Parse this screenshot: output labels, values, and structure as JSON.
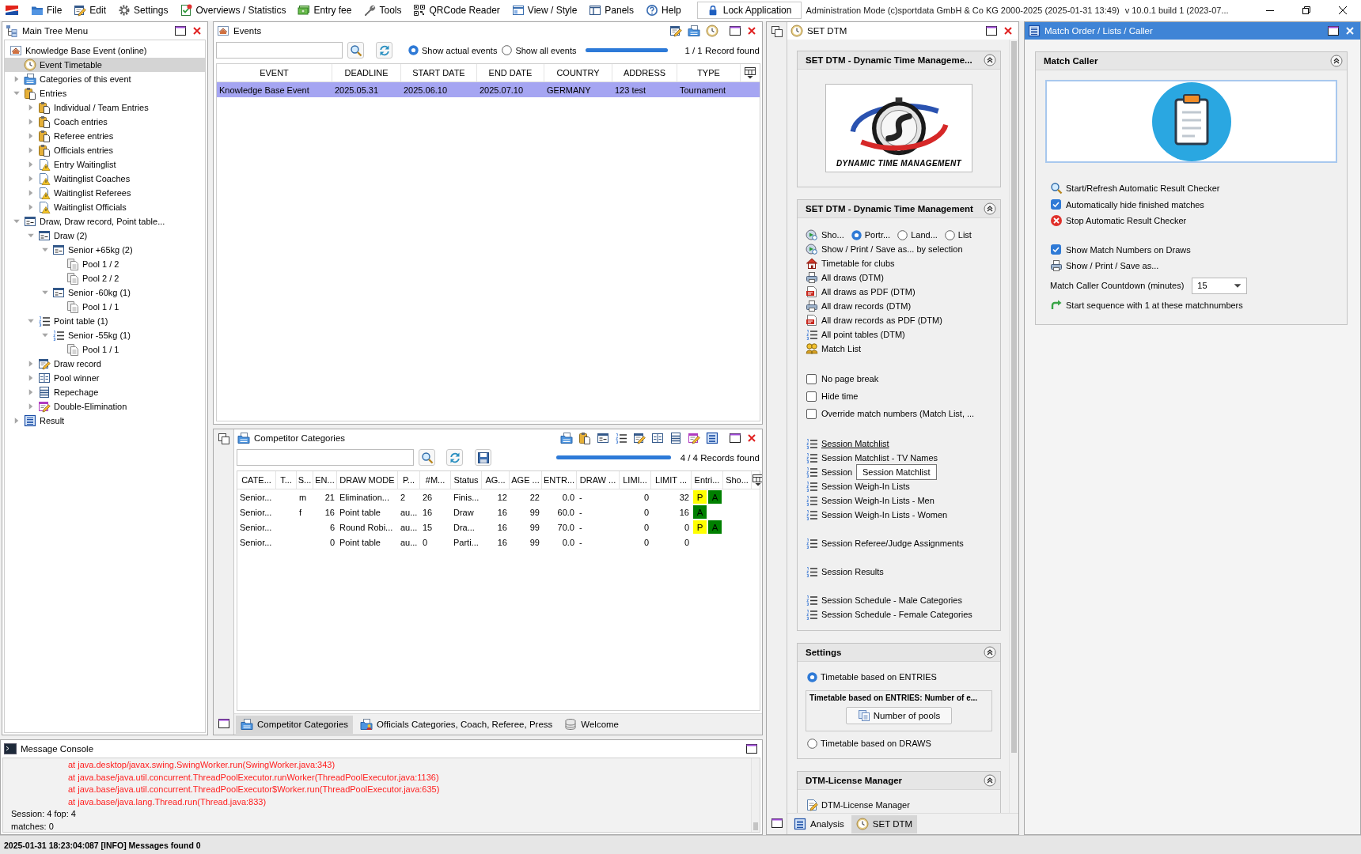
{
  "menubar": {
    "items": [
      {
        "label": "File",
        "kind": "file"
      },
      {
        "label": "Edit",
        "kind": "edit"
      },
      {
        "label": "Settings",
        "kind": "settings"
      },
      {
        "label": "Overviews / Statistics",
        "kind": "overview"
      },
      {
        "label": "Entry fee",
        "kind": "fee"
      },
      {
        "label": "Tools",
        "kind": "tools"
      },
      {
        "label": "QRCode Reader",
        "kind": "qr"
      },
      {
        "label": "View / Style",
        "kind": "view"
      },
      {
        "label": "Panels",
        "kind": "panels"
      },
      {
        "label": "Help",
        "kind": "help"
      }
    ],
    "lock_button": "Lock Application",
    "title": "Administration Mode (c)sportdata GmbH & Co KG 2000-2025 (2025-01-31 13:49)",
    "version": "v 10.0.1 build 1 (2023-07..."
  },
  "tree_panel": {
    "title": "Main Tree Menu",
    "active": false,
    "items": [
      {
        "label": "Knowledge Base Event (online)",
        "kind": "event",
        "selected": false,
        "children": [
          {
            "label": "Event Timetable",
            "kind": "timetable",
            "selected": true
          },
          {
            "label": "Categories of this event",
            "kind": "categories",
            "selected": false,
            "expanded": false
          },
          {
            "label": "Entries",
            "kind": "entries",
            "selected": false,
            "expanded": true,
            "children": [
              {
                "label": "Individual / Team Entries",
                "kind": "entries",
                "selected": false,
                "expanded": false
              },
              {
                "label": "Coach entries",
                "kind": "entries",
                "selected": false,
                "expanded": false
              },
              {
                "label": "Referee entries",
                "kind": "entries",
                "selected": false,
                "expanded": false
              },
              {
                "label": "Officials entries",
                "kind": "entries",
                "selected": false,
                "expanded": false
              },
              {
                "label": "Entry Waitinglist",
                "kind": "waitinglist",
                "selected": false,
                "expanded": false
              },
              {
                "label": "Waitinglist Coaches",
                "kind": "waitinglist",
                "selected": false,
                "expanded": false
              },
              {
                "label": "Waitinglist Referees",
                "kind": "waitinglist",
                "selected": false,
                "expanded": false
              },
              {
                "label": "Waitinglist Officials",
                "kind": "waitinglist",
                "selected": false,
                "expanded": false
              }
            ]
          },
          {
            "label": "Draw, Draw record, Point table...",
            "kind": "draw",
            "selected": false,
            "expanded": true,
            "children": [
              {
                "label": "Draw (2)",
                "kind": "draw",
                "selected": false,
                "expanded": true,
                "children": [
                  {
                    "label": "Senior +65kg (2)",
                    "kind": "draw",
                    "selected": false,
                    "expanded": true,
                    "children": [
                      {
                        "label": "Pool 1 / 2",
                        "kind": "pool",
                        "selected": false
                      },
                      {
                        "label": "Pool 2 / 2",
                        "kind": "pool",
                        "selected": false
                      }
                    ]
                  },
                  {
                    "label": "Senior -60kg (1)",
                    "kind": "draw",
                    "selected": false,
                    "expanded": true,
                    "children": [
                      {
                        "label": "Pool 1 / 1",
                        "kind": "pool",
                        "selected": false
                      }
                    ]
                  }
                ]
              },
              {
                "label": "Point table (1)",
                "kind": "pointtable",
                "selected": false,
                "expanded": true,
                "children": [
                  {
                    "label": "Senior -55kg (1)",
                    "kind": "pointtable",
                    "selected": false,
                    "expanded": true,
                    "children": [
                      {
                        "label": "Pool 1 / 1",
                        "kind": "pool",
                        "selected": false
                      }
                    ]
                  }
                ]
              },
              {
                "label": "Draw record",
                "kind": "record",
                "selected": false,
                "expanded": false
              },
              {
                "label": "Pool winner",
                "kind": "winner",
                "selected": false,
                "expanded": false
              },
              {
                "label": "Repechage",
                "kind": "repechage",
                "selected": false,
                "expanded": false
              },
              {
                "label": "Double-Elimination",
                "kind": "elimination",
                "selected": false,
                "expanded": false
              }
            ]
          },
          {
            "label": "Result",
            "kind": "result",
            "selected": false,
            "expanded": false
          }
        ]
      }
    ]
  },
  "events_panel": {
    "title": "Events",
    "active": false,
    "radios": [
      {
        "label": "Show actual events",
        "selected": true
      },
      {
        "label": "Show all events",
        "selected": false
      }
    ],
    "progress": {
      "level": 1
    },
    "record_count": "1 / 1 Record found",
    "table": {
      "columns": [
        "EVENT",
        "DEADLINE",
        "START DATE",
        "END DATE",
        "COUNTRY",
        "ADDRESS",
        "TYPE"
      ],
      "rows": [
        {
          "selected": true,
          "cells": [
            "Knowledge Base Event",
            "2025.05.31",
            "2025.06.10",
            "2025.07.10",
            "GERMANY",
            "123 test",
            "Tournament"
          ]
        }
      ]
    }
  },
  "categories_panel": {
    "title": "Competitor Categories",
    "active": false,
    "progress": {
      "level": 1
    },
    "record_count": "4 / 4 Records found",
    "table": {
      "columns": [
        "CATE...",
        "T...",
        "S...",
        "EN...",
        "DRAW MODE",
        "P...",
        "#M...",
        "Status",
        "AG...",
        "AGE ...",
        "ENTR...",
        "DRAW ...",
        "LIMI...",
        "LIMIT ...",
        "Entri...",
        "Sho..."
      ],
      "rows": [
        {
          "cells": [
            "Senior...",
            null,
            "m",
            "21",
            "Elimination...",
            "2",
            "26",
            "Finis...",
            "12",
            "22",
            "0.0",
            "-",
            "0",
            "32"
          ],
          "entries": [
            {
              "label": "P",
              "color": "#ffff00"
            },
            {
              "label": "A",
              "color": "#008000"
            }
          ]
        },
        {
          "cells": [
            "Senior...",
            null,
            "f",
            "16",
            "Point table",
            "au...",
            "16",
            "Draw",
            "16",
            "99",
            "60.0",
            "-",
            "0",
            "16"
          ],
          "entries": [
            {
              "label": "A",
              "color": "#008000"
            }
          ]
        },
        {
          "cells": [
            "Senior...",
            null,
            null,
            "6",
            "Round Robi...",
            "au...",
            "15",
            "Dra...",
            "16",
            "99",
            "70.0",
            "-",
            "0",
            "0"
          ],
          "entries": [
            {
              "label": "P",
              "color": "#ffff00"
            },
            {
              "label": "A",
              "color": "#008000"
            }
          ]
        },
        {
          "cells": [
            "Senior...",
            null,
            null,
            "0",
            "Point table",
            "au...",
            "0",
            "Parti...",
            "16",
            "99",
            "0.0",
            "-",
            "0",
            "0"
          ]
        }
      ]
    },
    "tabs": [
      {
        "label": "Competitor Categories",
        "kind": "categories",
        "selected": true
      },
      {
        "label": "Officials Categories, Coach, Referee, Press",
        "kind": "officials",
        "selected": false
      },
      {
        "label": "Welcome",
        "kind": "welcome",
        "selected": false
      }
    ]
  },
  "console": {
    "title": "Message Console",
    "active": false,
    "lines": [
      {
        "kind": "error",
        "text": "at java.desktop/javax.swing.SwingWorker.run(SwingWorker.java:343)"
      },
      {
        "kind": "error",
        "text": "at java.base/java.util.concurrent.ThreadPoolExecutor.runWorker(ThreadPoolExecutor.java:1136)"
      },
      {
        "kind": "error",
        "text": "at java.base/java.util.concurrent.ThreadPoolExecutor$Worker.run(ThreadPoolExecutor.java:635)"
      },
      {
        "kind": "error",
        "text": "at java.base/java.lang.Thread.run(Thread.java:833)"
      },
      {
        "kind": "info",
        "text": "Session: 4 fop: 4"
      },
      {
        "kind": "info",
        "text": "matches: 0"
      }
    ]
  },
  "status_bar": {
    "text": "2025-01-31 18:23:04:087 [INFO] Messages found 0"
  },
  "dtm_panel": {
    "title": "SET DTM",
    "active": false,
    "sections": [
      {
        "kind": "logo",
        "title": "SET DTM - Dynamic Time Manageme...",
        "expanded": true,
        "logo_text": "DYNAMIC TIME MANAGEMENT"
      },
      {
        "kind": "actions",
        "title": "SET DTM - Dynamic Time Management",
        "expanded": true,
        "groups": [
          {
            "items": [
              {
                "kind": "choice",
                "label": "Sho...",
                "options": [
                  {
                    "label": "Portr...",
                    "selected": true
                  },
                  {
                    "label": "Land...",
                    "selected": false
                  },
                  {
                    "label": "List",
                    "selected": false
                  }
                ]
              },
              {
                "kind": "show",
                "label": "Show / Print / Save as... by selection",
                "hovered": false
              },
              {
                "kind": "house",
                "label": "Timetable for clubs",
                "hovered": false
              },
              {
                "kind": "print",
                "label": "All draws (DTM)",
                "hovered": false
              },
              {
                "kind": "pdf",
                "label": "All draws as PDF (DTM)",
                "hovered": false
              },
              {
                "kind": "print",
                "label": "All draw records (DTM)",
                "hovered": false
              },
              {
                "kind": "pdf",
                "label": "All draw records as PDF (DTM)",
                "hovered": false
              },
              {
                "kind": "list",
                "label": "All point tables (DTM)",
                "hovered": false
              },
              {
                "kind": "people",
                "label": "Match List",
                "hovered": false
              }
            ]
          },
          {
            "items": [
              {
                "kind": "checkbox",
                "label": "No page break",
                "checked": false
              },
              {
                "kind": "checkbox",
                "label": "Hide time",
                "checked": false
              },
              {
                "kind": "checkbox",
                "label": "Override match numbers (Match List, ...",
                "checked": false
              }
            ]
          },
          {
            "items": [
              {
                "kind": "list",
                "label": "Session Matchlist",
                "hovered": true
              },
              {
                "kind": "list",
                "label": "Session Matchlist - TV Names",
                "hovered": false
              },
              {
                "kind": "list",
                "label": "Session",
                "hovered": false,
                "tooltip": "Session Matchlist"
              },
              {
                "kind": "list",
                "label": "Session Weigh-In Lists",
                "hovered": false
              },
              {
                "kind": "list",
                "label": "Session Weigh-In Lists - Men",
                "hovered": false
              },
              {
                "kind": "list",
                "label": "Session Weigh-In Lists - Women",
                "hovered": false
              }
            ]
          },
          {
            "items": [
              {
                "kind": "list",
                "label": "Session Referee/Judge Assignments",
                "hovered": false
              }
            ]
          },
          {
            "items": [
              {
                "kind": "list",
                "label": "Session Results",
                "hovered": false
              }
            ]
          },
          {
            "items": [
              {
                "kind": "list",
                "label": "Session Schedule - Male Categories",
                "hovered": false
              },
              {
                "kind": "list",
                "label": "Session Schedule - Female Categories",
                "hovered": false
              }
            ]
          }
        ]
      },
      {
        "kind": "settings",
        "title": "Settings",
        "expanded": true,
        "options": [
          {
            "label": "Timetable based on ENTRIES",
            "selected": true
          },
          {
            "label": "Timetable based on DRAWS",
            "selected": false
          }
        ],
        "group_title": "Timetable based on ENTRIES: Number of e...",
        "button": "Number of pools"
      },
      {
        "kind": "license",
        "title": "DTM-License Manager",
        "expanded": true,
        "items": [
          {
            "kind": "license",
            "label": "DTM-License Manager"
          }
        ]
      }
    ],
    "tabs": [
      {
        "label": "Analysis",
        "kind": "analysis",
        "selected": false
      },
      {
        "label": "SET DTM",
        "kind": "dtm",
        "selected": true
      }
    ]
  },
  "match_panel": {
    "title": "Match Order / Lists / Caller",
    "active": true,
    "card": {
      "title": "Match Caller",
      "expanded": true,
      "groups": [
        {
          "items": [
            {
              "kind": "search",
              "label": "Start/Refresh Automatic Result Checker"
            },
            {
              "kind": "checkbox",
              "label": "Automatically hide finished matches",
              "checked": true
            },
            {
              "kind": "stop",
              "label": "Stop Automatic Result Checker"
            }
          ]
        },
        {
          "items": [
            {
              "kind": "checkbox",
              "label": "Show Match Numbers on Draws",
              "checked": true
            },
            {
              "kind": "print",
              "label": "Show / Print / Save as..."
            },
            {
              "kind": "select",
              "label": "Match Caller Countdown (minutes)",
              "value": "15"
            },
            {
              "kind": "arrow",
              "label": "Start sequence with 1 at these matchnumbers"
            }
          ]
        }
      ]
    }
  }
}
